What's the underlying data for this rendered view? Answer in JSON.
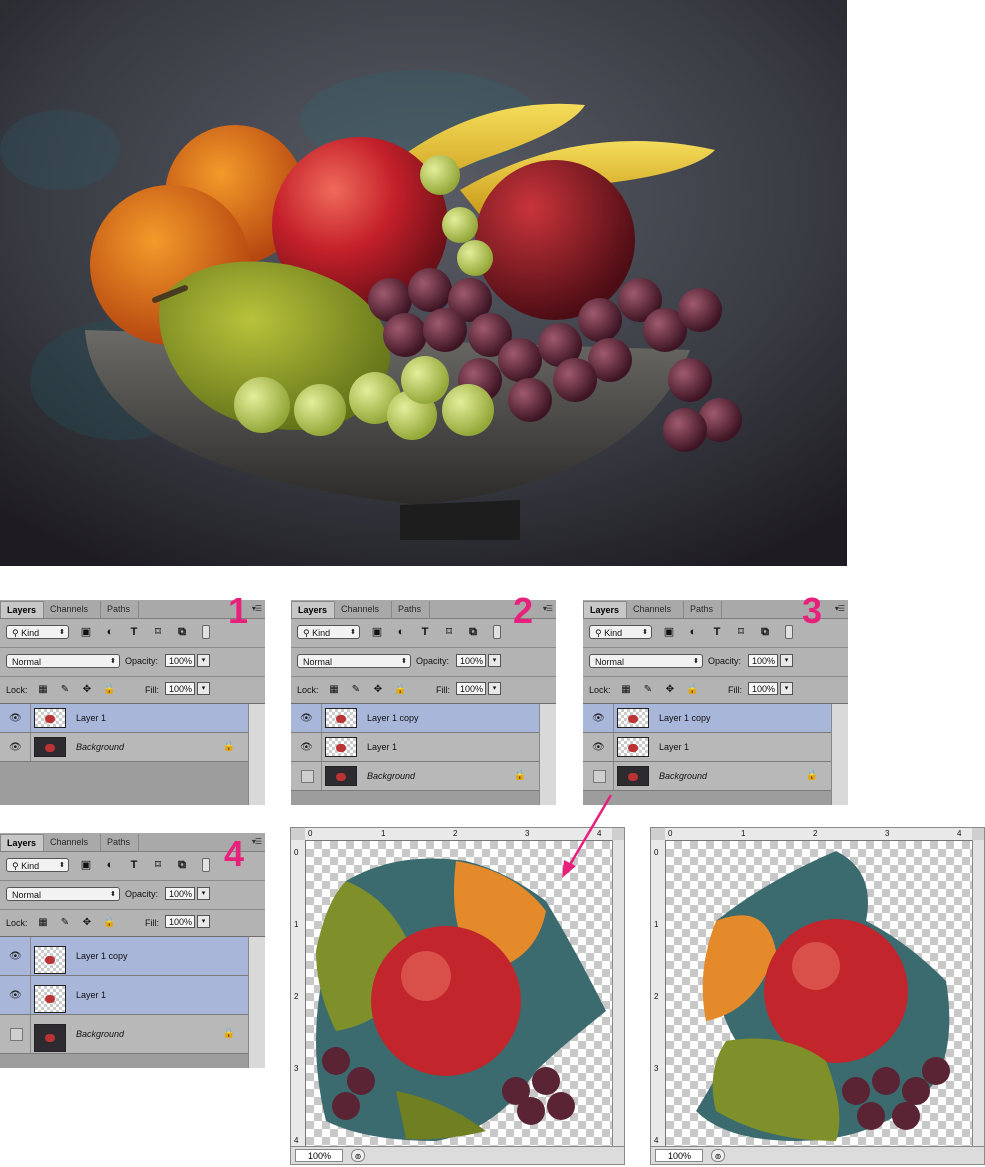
{
  "layers_panel": {
    "tabs": [
      "Layers",
      "Channels",
      "Paths"
    ],
    "filter_kind": "Kind",
    "blend_mode": "Normal",
    "opacity_label": "Opacity:",
    "opacity_value": "100%",
    "lock_label": "Lock:",
    "fill_label": "Fill:",
    "fill_value": "100%"
  },
  "panels": [
    {
      "number": "1",
      "layers": [
        {
          "name": "Layer 1",
          "visible": true,
          "selected": true,
          "locked": false
        },
        {
          "name": "Background",
          "visible": true,
          "selected": false,
          "locked": true
        }
      ]
    },
    {
      "number": "2",
      "layers": [
        {
          "name": "Layer 1 copy",
          "visible": true,
          "selected": true,
          "locked": false
        },
        {
          "name": "Layer 1",
          "visible": true,
          "selected": false,
          "locked": false
        },
        {
          "name": "Background",
          "visible": false,
          "selected": false,
          "locked": true
        }
      ]
    },
    {
      "number": "3",
      "layers": [
        {
          "name": "Layer 1 copy",
          "visible": true,
          "selected": true,
          "locked": false
        },
        {
          "name": "Layer 1",
          "visible": true,
          "selected": false,
          "locked": false
        },
        {
          "name": "Background",
          "visible": false,
          "selected": false,
          "locked": true
        }
      ]
    },
    {
      "number": "4",
      "layers": [
        {
          "name": "Layer 1 copy",
          "visible": true,
          "selected": true,
          "locked": false
        },
        {
          "name": "Layer 1",
          "visible": true,
          "selected": true,
          "locked": false
        },
        {
          "name": "Background",
          "visible": false,
          "selected": false,
          "locked": true
        }
      ]
    }
  ],
  "canvas": {
    "ruler_h": [
      "0",
      "1",
      "2",
      "3",
      "4"
    ],
    "ruler_v": [
      "0",
      "1",
      "2",
      "3",
      "4"
    ],
    "zoom": "100%"
  },
  "colors": {
    "accent_number": "#e8207b",
    "selected_layer": "#a8b6d9"
  }
}
